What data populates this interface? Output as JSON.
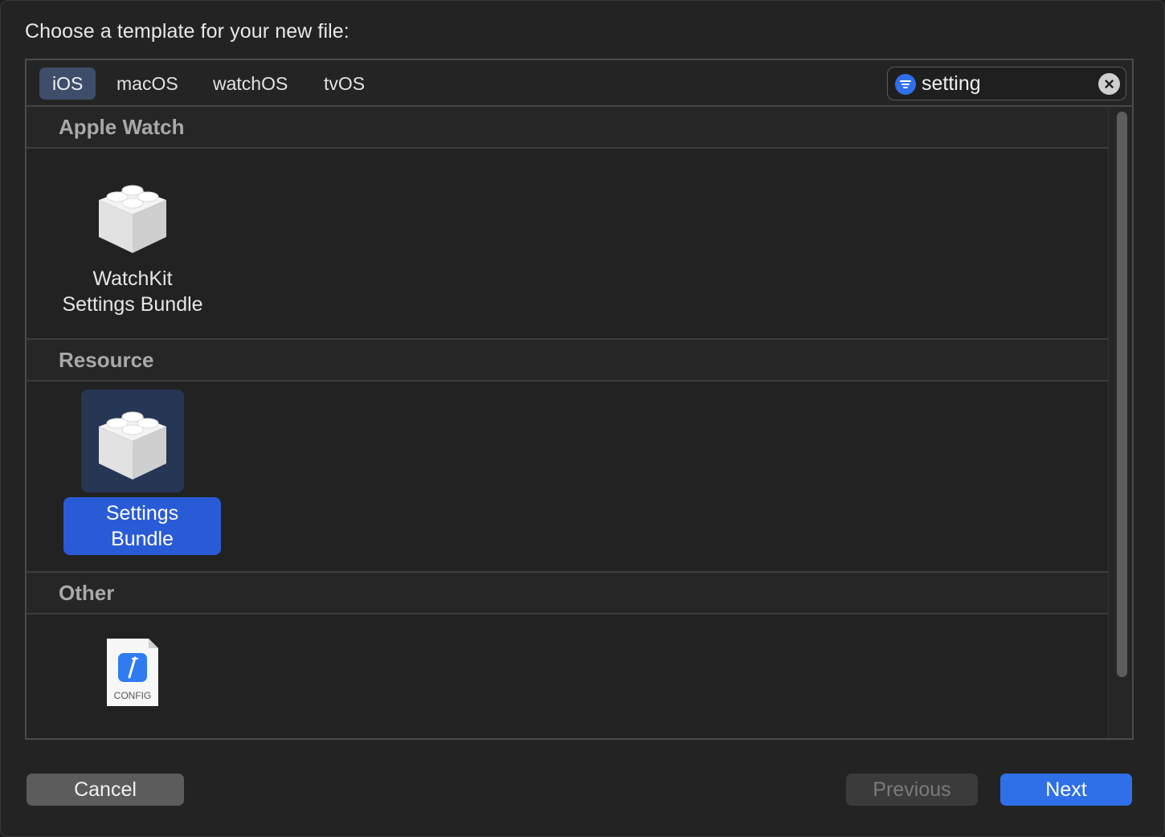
{
  "dialog": {
    "prompt": "Choose a template for your new file:"
  },
  "tabs": [
    {
      "label": "iOS",
      "active": true
    },
    {
      "label": "macOS",
      "active": false
    },
    {
      "label": "watchOS",
      "active": false
    },
    {
      "label": "tvOS",
      "active": false
    }
  ],
  "search": {
    "value": "setting",
    "filter_icon": "filter-icon",
    "clear_icon": "clear-icon"
  },
  "sections": [
    {
      "header": "Apple Watch",
      "items": [
        {
          "icon": "lego-brick-icon",
          "label_line1": "WatchKit",
          "label_line2": "Settings Bundle",
          "selected": false
        }
      ]
    },
    {
      "header": "Resource",
      "items": [
        {
          "icon": "lego-brick-icon",
          "label": "Settings Bundle",
          "selected": true
        }
      ]
    },
    {
      "header": "Other",
      "items": [
        {
          "icon": "config-file-icon",
          "icon_text": "CONFIG",
          "selected": false
        }
      ]
    }
  ],
  "buttons": {
    "cancel": "Cancel",
    "previous": "Previous",
    "next": "Next"
  },
  "colors": {
    "accent": "#2f6fe8",
    "selection": "#2a5bd7"
  }
}
